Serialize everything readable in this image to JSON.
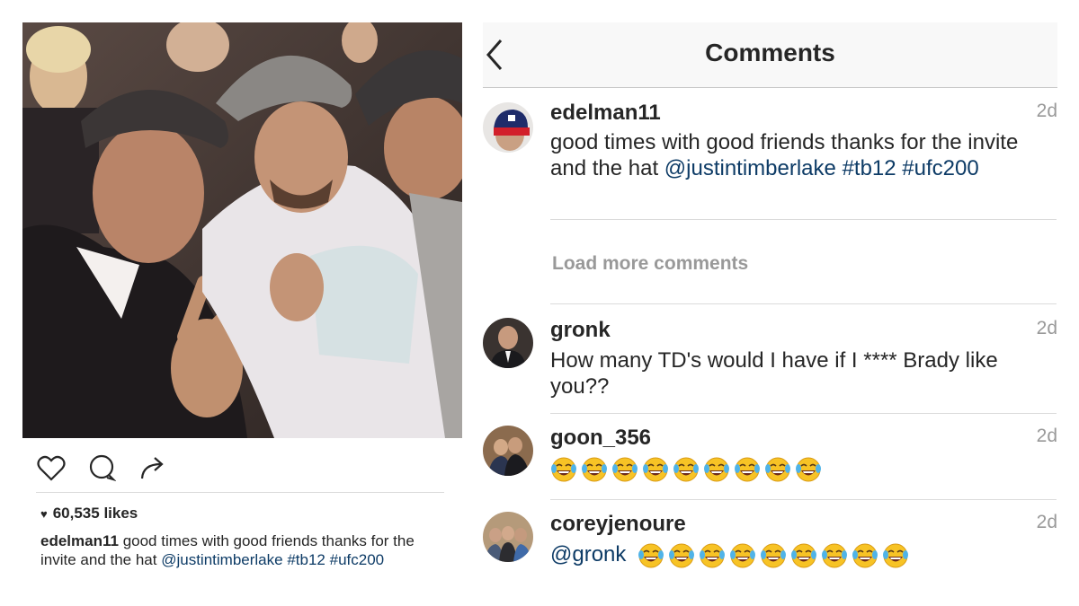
{
  "post": {
    "photo_description": "",
    "likes_count": "60,535 likes",
    "caption_user": "edelman11",
    "caption_text": "good times with good friends thanks for the invite and the hat",
    "caption_mention": "@justintimberlake",
    "caption_tags": [
      "#tb12",
      "#ufc200"
    ]
  },
  "header": {
    "title": "Comments",
    "back_icon": "chevron-left-icon"
  },
  "main_comment": {
    "user": "edelman11",
    "time": "2d",
    "text": "good times with good friends thanks for the invite and the hat",
    "mention": "@justintimberlake",
    "tag1": "#tb12",
    "tag2": "#ufc200"
  },
  "load_more": "Load more comments",
  "comments": [
    {
      "user": "gronk",
      "time": "2d",
      "text": "How many TD's would I have if I **** Brady like you??"
    },
    {
      "user": "goon_356",
      "time": "2d",
      "emoji_count": 9,
      "emoji_name": "tears-of-joy-emoji"
    },
    {
      "user": "coreyjenoure",
      "time": "2d",
      "mention": "@gronk",
      "emoji_count": 9,
      "emoji_name": "tears-of-joy-emoji"
    }
  ],
  "colors": {
    "link": "#0d3b66",
    "muted": "#999999",
    "text": "#262626",
    "divider": "#dbdbdb"
  },
  "icons": [
    "heart-icon",
    "comment-icon",
    "share-icon",
    "chevron-left-icon"
  ]
}
